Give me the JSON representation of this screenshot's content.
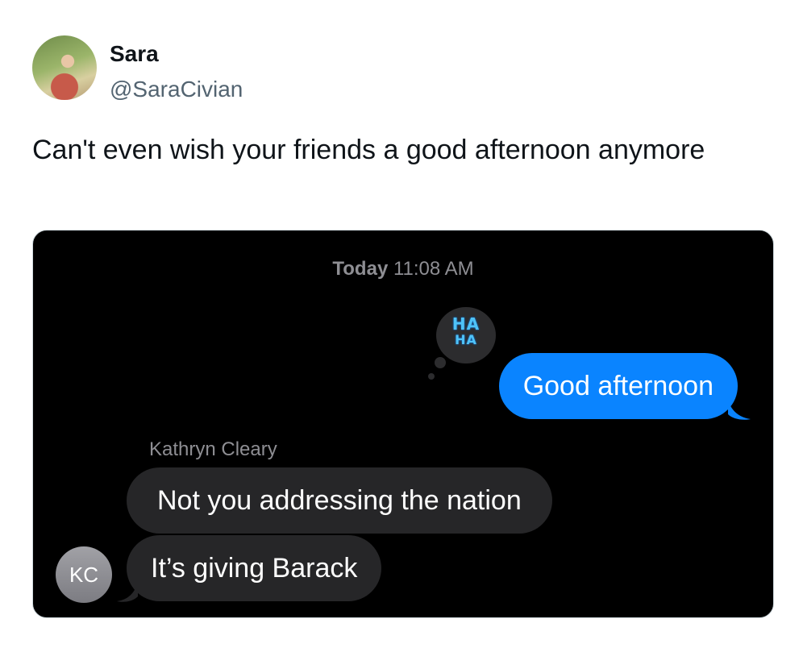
{
  "tweet": {
    "author_name": "Sara",
    "handle": "@SaraCivian",
    "text": "Can't even wish your friends a good afternoon anymore"
  },
  "conversation": {
    "timestamp_day": "Today",
    "timestamp_time": "11:08 AM",
    "tapback": {
      "line1": "HA",
      "line2": "HA",
      "color": "#4fc3f7"
    },
    "sent_message": "Good afternoon",
    "sender_name": "Kathryn Cleary",
    "received_messages": [
      "Not you addressing the nation",
      "It’s giving Barack"
    ],
    "sender_initials": "KC"
  },
  "colors": {
    "sent_bubble": "#0a84ff",
    "received_bubble": "#262628",
    "chat_background": "#000000"
  }
}
